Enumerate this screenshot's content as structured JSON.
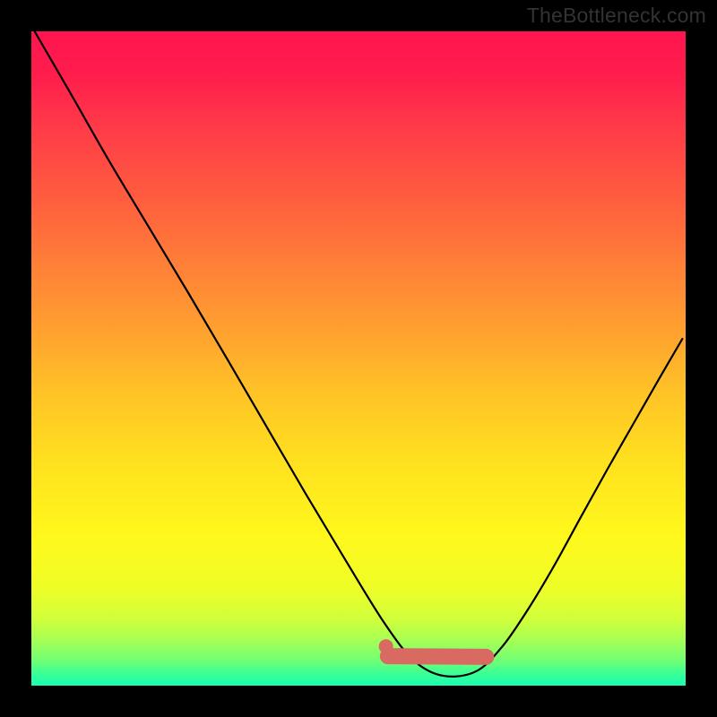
{
  "watermark": "TheBottleneck.com",
  "chart_data": {
    "type": "line",
    "title": "",
    "xlabel": "",
    "ylabel": "",
    "xlim": [
      0,
      1
    ],
    "ylim": [
      0,
      1
    ],
    "series": [
      {
        "name": "curve",
        "x": [
          0.005,
          0.06,
          0.12,
          0.18,
          0.24,
          0.3,
          0.36,
          0.42,
          0.48,
          0.54,
          0.585,
          0.63,
          0.68,
          0.72,
          0.76,
          0.8,
          0.84,
          0.88,
          0.92,
          0.96,
          0.995
        ],
        "y": [
          1.0,
          0.905,
          0.8,
          0.7,
          0.6,
          0.498,
          0.395,
          0.292,
          0.192,
          0.095,
          0.038,
          0.015,
          0.022,
          0.06,
          0.118,
          0.185,
          0.258,
          0.33,
          0.4,
          0.47,
          0.53
        ]
      }
    ],
    "annotations": [
      {
        "name": "valley-band",
        "type": "segment",
        "x": [
          0.545,
          0.695
        ],
        "y": [
          0.045,
          0.044
        ],
        "color": "#d96a62",
        "width": 18,
        "cap": "round"
      },
      {
        "name": "valley-dot",
        "type": "point",
        "x": 0.542,
        "y": 0.06,
        "r": 8,
        "color": "#d96a62"
      }
    ]
  }
}
